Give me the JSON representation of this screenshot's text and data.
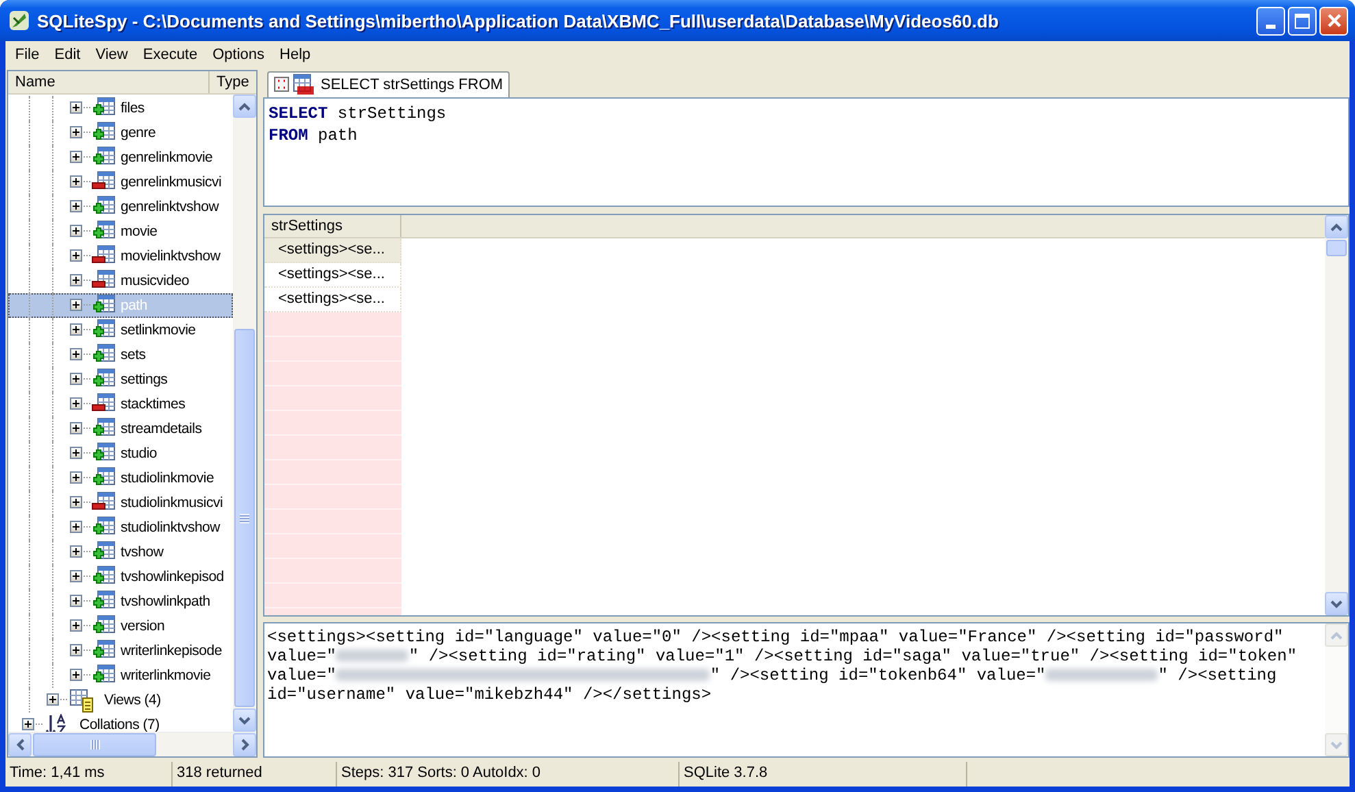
{
  "window": {
    "title": "SQLiteSpy - C:\\Documents and Settings\\mibertho\\Application Data\\XBMC_Full\\userdata\\Database\\MyVideos60.db"
  },
  "menu": [
    {
      "label": "File"
    },
    {
      "label": "Edit"
    },
    {
      "label": "View"
    },
    {
      "label": "Execute"
    },
    {
      "label": "Options"
    },
    {
      "label": "Help"
    }
  ],
  "tree": {
    "columns": [
      "Name",
      "Type"
    ],
    "tables": [
      {
        "label": "files",
        "kind": "plus",
        "expanded": false,
        "selected": false
      },
      {
        "label": "genre",
        "kind": "plus",
        "expanded": false,
        "selected": false
      },
      {
        "label": "genrelinkmovie",
        "kind": "plus",
        "expanded": false,
        "selected": false
      },
      {
        "label": "genrelinkmusicvi",
        "kind": "minus",
        "expanded": false,
        "selected": false
      },
      {
        "label": "genrelinktvshow",
        "kind": "plus",
        "expanded": false,
        "selected": false
      },
      {
        "label": "movie",
        "kind": "plus",
        "expanded": false,
        "selected": false
      },
      {
        "label": "movielinktvshow",
        "kind": "minus",
        "expanded": false,
        "selected": false
      },
      {
        "label": "musicvideo",
        "kind": "minus",
        "expanded": false,
        "selected": false
      },
      {
        "label": "path",
        "kind": "plus",
        "expanded": false,
        "selected": true
      },
      {
        "label": "setlinkmovie",
        "kind": "plus",
        "expanded": false,
        "selected": false
      },
      {
        "label": "sets",
        "kind": "plus",
        "expanded": false,
        "selected": false
      },
      {
        "label": "settings",
        "kind": "plus",
        "expanded": false,
        "selected": false
      },
      {
        "label": "stacktimes",
        "kind": "minus",
        "expanded": false,
        "selected": false
      },
      {
        "label": "streamdetails",
        "kind": "plus",
        "expanded": false,
        "selected": false
      },
      {
        "label": "studio",
        "kind": "plus",
        "expanded": false,
        "selected": false
      },
      {
        "label": "studiolinkmovie",
        "kind": "plus",
        "expanded": false,
        "selected": false
      },
      {
        "label": "studiolinkmusicvi",
        "kind": "minus",
        "expanded": false,
        "selected": false
      },
      {
        "label": "studiolinktvshow",
        "kind": "plus",
        "expanded": false,
        "selected": false
      },
      {
        "label": "tvshow",
        "kind": "plus",
        "expanded": false,
        "selected": false
      },
      {
        "label": "tvshowlinkepisod",
        "kind": "plus",
        "expanded": false,
        "selected": false
      },
      {
        "label": "tvshowlinkpath",
        "kind": "plus",
        "expanded": false,
        "selected": false
      },
      {
        "label": "version",
        "kind": "plus",
        "expanded": false,
        "selected": false
      },
      {
        "label": "writerlinkepisode",
        "kind": "plus",
        "expanded": false,
        "selected": false
      },
      {
        "label": "writerlinkmovie",
        "kind": "plus",
        "expanded": false,
        "selected": false
      }
    ],
    "views": {
      "label": "Views (4)",
      "expanded": false,
      "selected": false
    },
    "collations": {
      "label": "Collations (7)",
      "expanded": false,
      "selected": false
    }
  },
  "tabs": [
    {
      "label": "SELECT strSettings FROM",
      "selected": true
    }
  ],
  "editor": {
    "lines": [
      [
        {
          "kind": "keyword",
          "text": "SELECT"
        },
        {
          "kind": "plain",
          "text": " strSettings"
        }
      ],
      [
        {
          "kind": "keyword",
          "text": "FROM"
        },
        {
          "kind": "plain",
          "text": " path"
        }
      ]
    ]
  },
  "grid": {
    "columns": [
      "strSettings"
    ],
    "rows": [
      {
        "cells": [
          "<settings><se..."
        ],
        "selected": true
      },
      {
        "cells": [
          "<settings><se..."
        ],
        "selected": false
      },
      {
        "cells": [
          "<settings><se..."
        ],
        "selected": false
      }
    ]
  },
  "detail": {
    "segments": [
      {
        "kind": "text",
        "text": "<settings><setting id=\"language\" value=\"0\" /><setting id=\"mpaa\" value=\"France\" /><setting id=\"password\" value=\""
      },
      {
        "kind": "redacted"
      },
      {
        "kind": "text",
        "text": "\" /><setting id=\"rating\" value=\"1\" /><setting id=\"saga\" value=\"true\" /><setting id=\"token\" value=\""
      },
      {
        "kind": "redacted"
      },
      {
        "kind": "text",
        "text": "\" /><setting id=\"tokenb64\" value=\""
      },
      {
        "kind": "redacted"
      },
      {
        "kind": "text",
        "text": "\" /><setting id=\"username\" value=\"mikebzh44\" /></settings>"
      }
    ]
  },
  "status_bar": [
    "Time: 1,41 ms",
    "318 returned",
    "Steps: 317 Sorts: 0 AutoIdx: 0",
    "SQLite 3.7.8"
  ]
}
